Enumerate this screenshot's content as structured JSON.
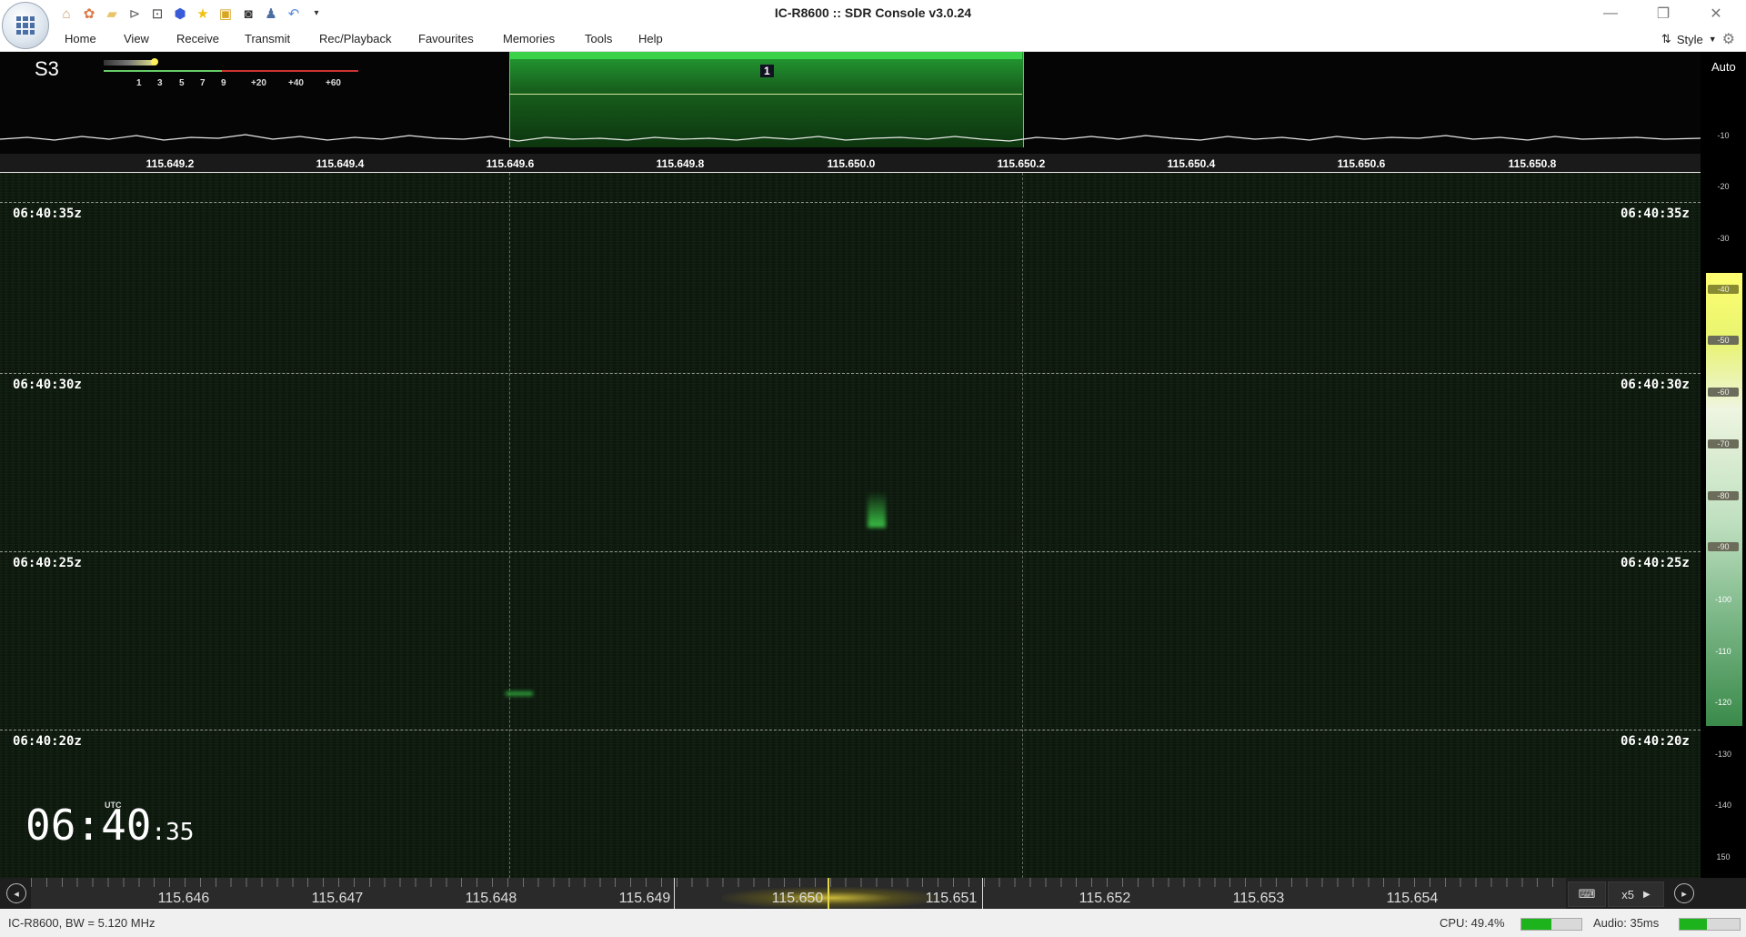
{
  "window": {
    "title": "IC-R8600 :: SDR Console v3.0.24"
  },
  "quick_access": [
    "home-icon",
    "settings-icon",
    "folder-icon",
    "play-icon",
    "stop-icon",
    "record-icon",
    "favourite-star-icon",
    "lock-icon",
    "camera-icon",
    "person-icon",
    "undo-icon",
    "dropdown-arrow-icon"
  ],
  "menu": [
    "Home",
    "View",
    "Receive",
    "Transmit",
    "Rec/Playback",
    "Favourites",
    "Memories",
    "Tools",
    "Help"
  ],
  "style_label": "Style",
  "spectrum": {
    "s_meter": "S3",
    "scale_labels": [
      "1",
      "3",
      "5",
      "7",
      "9",
      "+20",
      "+40",
      "+60"
    ],
    "channel_number": "1",
    "freq_labels": [
      "115.649.2",
      "115.649.4",
      "115.649.6",
      "115.649.8",
      "115.650.0",
      "115.650.2",
      "115.650.4",
      "115.650.6",
      "115.650.8"
    ]
  },
  "waterfall": {
    "timestamps": [
      "06:40:35z",
      "06:40:30z",
      "06:40:25z",
      "06:40:20z"
    ],
    "clock_label": "UTC",
    "clock_hm": "06:40",
    "clock_sec": ":35"
  },
  "right_scale": {
    "auto_label": "Auto",
    "labels": [
      "-10",
      "-20",
      "-30",
      "-40",
      "-50",
      "-60",
      "-70",
      "-80",
      "-90",
      "-100",
      "-110",
      "-120",
      "-130",
      "-140",
      "150"
    ]
  },
  "bottom_scale": {
    "labels": [
      "115.646",
      "115.647",
      "115.648",
      "115.649",
      "115.650",
      "115.651",
      "115.652",
      "115.653",
      "115.654"
    ],
    "zoom": "x5"
  },
  "status": {
    "left": "IC-R8600, BW = 5.120 MHz",
    "cpu_label": "CPU: 49.4%",
    "cpu_level": 0.494,
    "audio_label": "Audio: 35ms",
    "audio_level": 0.45
  }
}
